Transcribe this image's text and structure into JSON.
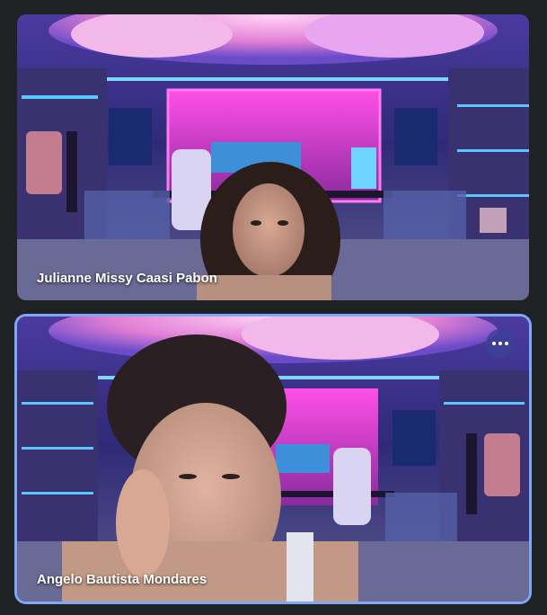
{
  "participants": [
    {
      "name": "Julianne Missy Caasi Pabon",
      "active_speaker": false
    },
    {
      "name": "Angelo Bautista Mondares",
      "active_speaker": true,
      "more_options_icon": "more-horizontal-icon"
    }
  ],
  "colors": {
    "page_background": "#202124",
    "active_border": "#7fa7f5",
    "neon_pink": "#e040e0",
    "neon_blue": "#3fa9ff",
    "clouds": "#f3a6e8"
  }
}
